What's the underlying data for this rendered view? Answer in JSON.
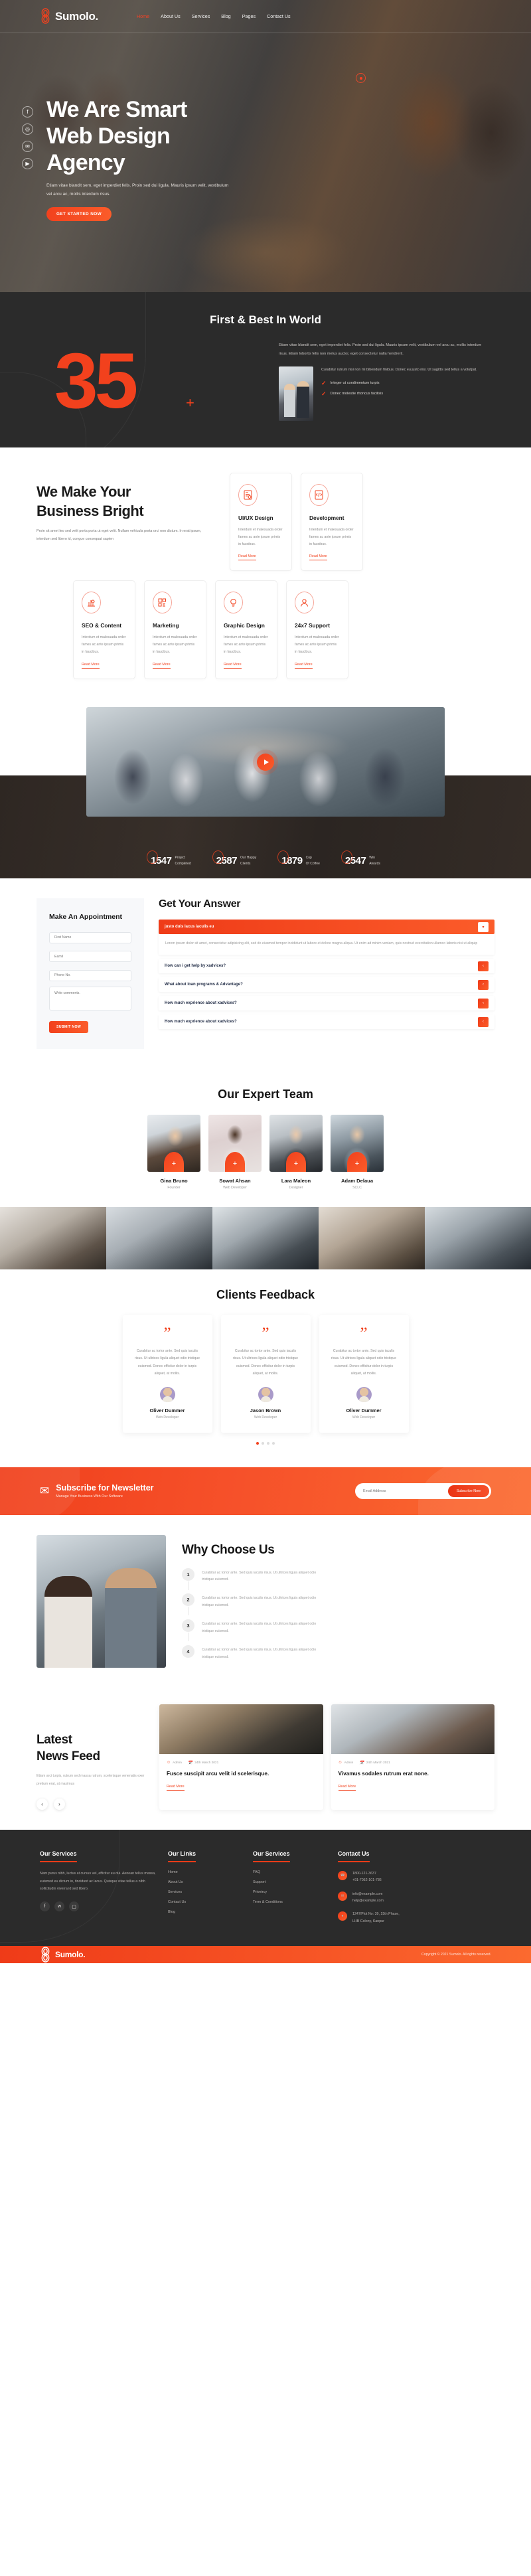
{
  "brand": {
    "name": "Sumolo.",
    "accent": "#f2411d",
    "dark": "#2b2b2b"
  },
  "header": {
    "nav": [
      {
        "label": "Home"
      },
      {
        "label": "About Us"
      },
      {
        "label": "Services"
      },
      {
        "label": "Blog"
      },
      {
        "label": "Pages"
      },
      {
        "label": "Contact Us"
      }
    ],
    "social": [
      {
        "name": "facebook-icon",
        "glyph": "f"
      },
      {
        "name": "dribbble-icon",
        "glyph": "◎"
      },
      {
        "name": "twitter-icon",
        "glyph": "✉"
      },
      {
        "name": "youtube-icon",
        "glyph": "▶"
      }
    ]
  },
  "hero": {
    "title_line1": "We Are Smart",
    "title_line2": "Web Design",
    "title_line3": "Agency",
    "paragraph": "Etiam vitae blandit sem, eget imperdiet felis. Proin sed dui ligula. Mauris ipsum velit, vestibulum vel arcu ac, mollis interdum risus.",
    "cta": "GET STARTED NOW"
  },
  "first_best": {
    "title": "First & Best In World",
    "number": "35",
    "plus": "+",
    "paragraph": "Etiam vitae blandit sem, eget imperdiet felis. Proin sed dui ligula. Mauris ipsum velit, vestibulum vel arcu ac, mollis interdum risus. Etiam lobortis felis non metus auctor, eget consectetur nulla hendrerit.",
    "sub_paragraph": "Curabitur rutrum nisi non mi bibendum finibus. Donec eu justo nisi. Ut sagittis sed tellus a volutpat.",
    "checks": [
      "Integer ut condimentum turpis",
      "Donec molestie rhoncus facilisis"
    ]
  },
  "services": {
    "heading_line1": "We Make Your",
    "heading_line2": "Business Bright",
    "paragraph": "Proin sit amet leo sed velit porta porta ut eget velit. Nullam vehicula porta orci non dictum. In erat ipsum, interdum sed libero id, congue consequat sapien",
    "read_more": "Read More",
    "card_text": "Interdum et malesuada order fames ac ante ipsum primis in faucibus.",
    "cards": [
      {
        "title": "UI/UX Design",
        "icon": "uiux-icon"
      },
      {
        "title": "Development",
        "icon": "code-icon"
      },
      {
        "title": "SEO & Content",
        "icon": "seo-icon"
      },
      {
        "title": "Marketing",
        "icon": "marketing-icon"
      },
      {
        "title": "Graphic Design",
        "icon": "graphic-icon"
      },
      {
        "title": "24x7 Support",
        "icon": "support-icon"
      }
    ]
  },
  "stats": [
    {
      "number": "1547",
      "line1": "Project",
      "line2": "Completed"
    },
    {
      "number": "2587",
      "line1": "Our Happy",
      "line2": "Clients"
    },
    {
      "number": "1879",
      "line1": "Cup",
      "line2": "Of Coffee"
    },
    {
      "number": "2547",
      "line1": "Win",
      "line2": "Awards"
    }
  ],
  "appointment": {
    "title": "Make An Appointment",
    "fields": [
      {
        "name": "first-name-input",
        "placeholder": "First Name",
        "value": ""
      },
      {
        "name": "email-input",
        "placeholder": "Eamil",
        "value": ""
      },
      {
        "name": "phone-input",
        "placeholder": "Phone No.",
        "value": ""
      }
    ],
    "comments_placeholder": "Write comments.",
    "submit": "SUBMIT NOW"
  },
  "faq": {
    "title": "Get Your Answer",
    "items": [
      {
        "question": "justo duis lacus iaculis eu",
        "open": true,
        "answer": "Lorem ipsum dolor sit amet, consectetur adipisicing elit, sed do eiusmod tempor incididunt ut labore et dolore magna aliqua. Ut enim ad minim veniam, quis nostrud exercitation ullamco laboris nisi ut aliquip"
      },
      {
        "question": "How can i get help by xadvices?",
        "open": false,
        "answer": ""
      },
      {
        "question": "What about loan programs & Advantage?",
        "open": false,
        "answer": ""
      },
      {
        "question": "How much exprience about xadvices?",
        "open": false,
        "answer": ""
      },
      {
        "question": "How much exprience about xadvices?",
        "open": false,
        "answer": ""
      }
    ]
  },
  "team": {
    "title": "Our Expert Team",
    "members": [
      {
        "name": "Gina Bruno",
        "role": "Founder"
      },
      {
        "name": "Sowat Ahsan",
        "role": "Web Developer"
      },
      {
        "name": "Lara Maleon",
        "role": "Designer"
      },
      {
        "name": "Adam Delaua",
        "role": "SCLC"
      }
    ]
  },
  "feedback": {
    "title": "Clients Feedback",
    "quote_glyph": "”",
    "items": [
      {
        "text": "Curabitur ac tortor ante. Sed quis iaculis risus. Ut ultrices ligula aliquet odio tristique euismod. Donec efficitur dolor in turpis aliquet, at mollis.",
        "name": "Oliver Dummer",
        "role": "Web Developer"
      },
      {
        "text": "Curabitur ac tortor ante. Sed quis iaculis risus. Ut ultrices ligula aliquet odio tristique euismod. Donec efficitur dolor in turpis aliquet, at mollis.",
        "name": "Jason Brown",
        "role": "Web Developer"
      },
      {
        "text": "Curabitur ac tortor ante. Sed quis iaculis risus. Ut ultrices ligula aliquet odio tristique euismod. Donec efficitur dolor in turpis aliquet, at mollis.",
        "name": "Oliver Dummer",
        "role": "Web Developer"
      }
    ],
    "dots": 4,
    "active_dot": 0
  },
  "newsletter": {
    "title": "Subscribe for Newsletter",
    "subtitle": "Manage Your Business With Our Software",
    "placeholder": "Email Address",
    "value": "",
    "button": "Subscribe Now"
  },
  "why_choose": {
    "title": "Why Choose Us",
    "items": [
      {
        "num": "1",
        "text": "Curabitur ac tortor ante. Sed quis iaculis risus. Ut ultrices ligula aliquet odio tristique euismod."
      },
      {
        "num": "2",
        "text": "Curabitur ac tortor ante. Sed quis iaculis risus. Ut ultrices ligula aliquet odio tristique euismod."
      },
      {
        "num": "3",
        "text": "Curabitur ac tortor ante. Sed quis iaculis risus. Ut ultrices ligula aliquet odio tristique euismod."
      },
      {
        "num": "4",
        "text": "Curabitur ac tortor ante. Sed quis iaculis risus. Ut ultrices ligula aliquet odio tristique euismod."
      }
    ]
  },
  "news_feed": {
    "heading_line1": "Latest",
    "heading_line2": "News Feed",
    "paragraph": "Etiam arci turpis, rutrum sed massa rutrum, scelerisque venenatis exer pretium erat, at maximus",
    "prev": "‹",
    "next": "›",
    "read_more": "Read More",
    "posts": [
      {
        "author": "Admin",
        "date": "24th March 2021",
        "title": "Fusce suscipit arcu velit id scelerisque."
      },
      {
        "author": "Admin",
        "date": "24th March 2021",
        "title": "Vivamus sodales rutrum erat none."
      }
    ]
  },
  "footer": {
    "columns": {
      "services": {
        "title": "Our Services",
        "text": "Nam purus nibh, luctus at cursus vel, efficitur eu dui. Aenean tellus massa, euismod eu dictum in, tincidunt ac lacus. Quisque vitae tellus a nibh sollicitudin viverra id sed libero."
      },
      "links": {
        "title": "Our Links",
        "items": [
          "Home",
          "About Us",
          "Services",
          "Contact Us",
          "Blog"
        ]
      },
      "services2": {
        "title": "Our Services",
        "items": [
          "FAQ",
          "Support",
          "Priveircy",
          "Term & Conditions"
        ]
      },
      "contact": {
        "title": "Contact Us",
        "phone1": "1800-121-3637",
        "phone2": "+91-7052-101-786",
        "email1": "info@example.com",
        "email2": "help@example.com",
        "address1": "1247/Plot No: 39, 15th Phase,",
        "address2": "LHB Colony, Kanpur"
      }
    },
    "social": [
      {
        "name": "facebook-icon",
        "glyph": "f"
      },
      {
        "name": "twitter-icon",
        "glyph": "ᴛ"
      },
      {
        "name": "instagram-icon",
        "glyph": "▢"
      }
    ],
    "copyright": "Copyright © 2021 Sumolo. All rights reserved."
  }
}
